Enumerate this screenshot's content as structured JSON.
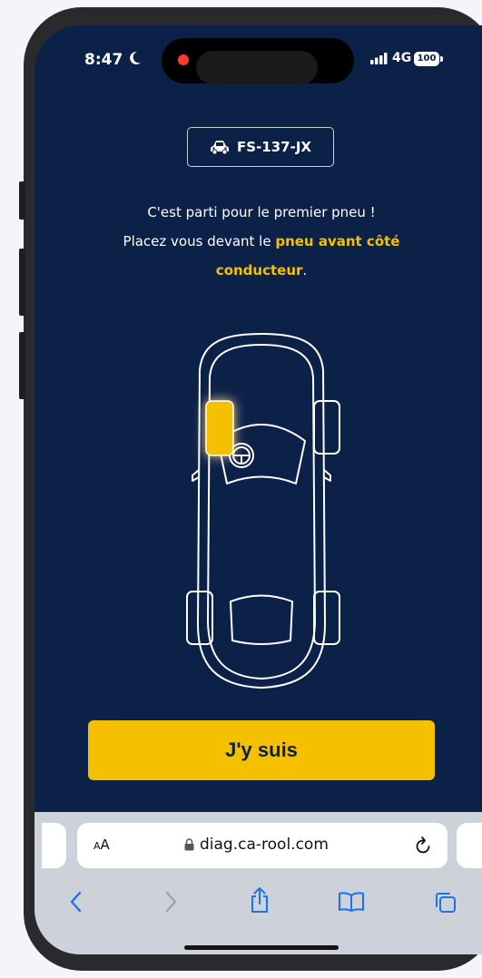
{
  "status_bar": {
    "time": "8:47",
    "network": "4G",
    "battery": "100"
  },
  "vehicle": {
    "plate": "FS-137-JX"
  },
  "instructions": {
    "line1": "C'est parti pour le premier pneu !",
    "line2_prefix": "Placez vous devant le ",
    "highlight_a": "pneu avant côté",
    "highlight_b": "conducteur",
    "suffix": "."
  },
  "car_diagram": {
    "highlighted_tire": "front-left",
    "highlight_color": "#f5c000",
    "line_color": "#ffffff"
  },
  "cta": {
    "label": "J'y suis"
  },
  "browser": {
    "reader_label_small": "A",
    "reader_label_large": "A",
    "url": "diag.ca-rool.com",
    "toolbar": [
      "back-icon",
      "forward-icon",
      "share-icon",
      "bookmarks-icon",
      "tabs-icon"
    ]
  },
  "colors": {
    "background": "#0c2148",
    "accent": "#f5c000"
  }
}
